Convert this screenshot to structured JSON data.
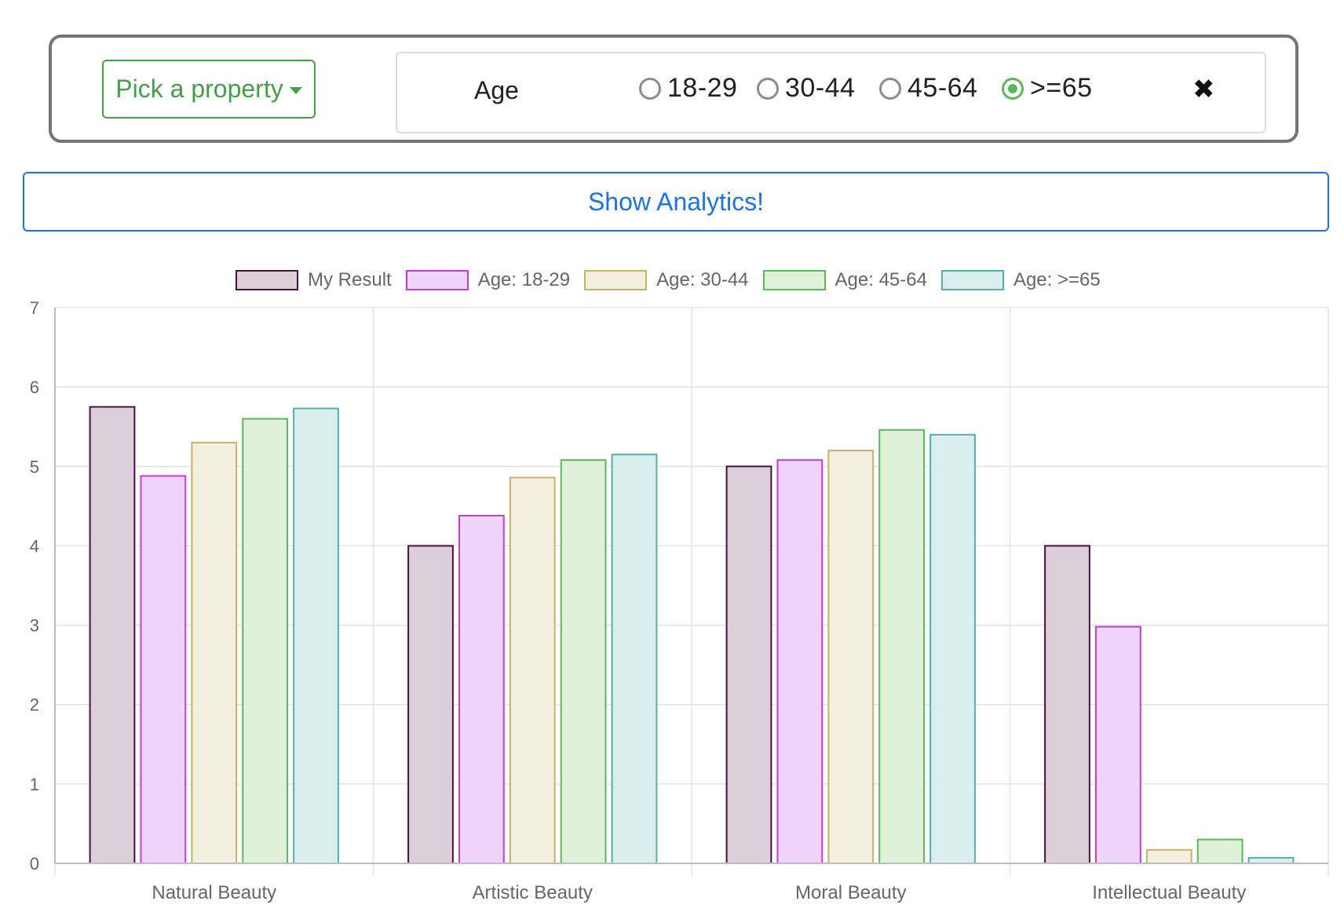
{
  "filter": {
    "pick_label": "Pick a property",
    "property_name": "Age",
    "options": [
      {
        "label": "18-29",
        "checked": false
      },
      {
        "label": "30-44",
        "checked": false
      },
      {
        "label": "45-64",
        "checked": false
      },
      {
        "label": ">=65",
        "checked": true
      }
    ],
    "close_icon": "close-icon"
  },
  "analytics_button_label": "Show Analytics!",
  "chart_data": {
    "type": "bar",
    "categories": [
      "Natural Beauty",
      "Artistic Beauty",
      "Moral Beauty",
      "Intellectual Beauty"
    ],
    "ylim": [
      0,
      7
    ],
    "yticks": [
      "0",
      "1",
      "2",
      "3",
      "4",
      "5",
      "6",
      "7"
    ],
    "grid": true,
    "legend_position": "top-center",
    "series": [
      {
        "name": "My Result",
        "values": [
          5.75,
          4.0,
          5.0,
          4.0
        ],
        "fill": "#dbd0da",
        "stroke": "#4a1040"
      },
      {
        "name": "Age: 18-29",
        "values": [
          4.88,
          4.38,
          5.08,
          2.98
        ],
        "fill": "#f1d4fb",
        "stroke": "#c23cd8"
      },
      {
        "name": "Age: 30-44",
        "values": [
          5.3,
          4.86,
          5.2,
          0.17
        ],
        "fill": "#f3efdf",
        "stroke": "#c9b06b"
      },
      {
        "name": "Age: 45-64",
        "values": [
          5.6,
          5.08,
          5.46,
          0.3
        ],
        "fill": "#dff0d8",
        "stroke": "#5cb85c"
      },
      {
        "name": "Age: >=65",
        "values": [
          5.73,
          5.15,
          5.4,
          0.07
        ],
        "fill": "#daeeed",
        "stroke": "#54b0ad"
      }
    ]
  }
}
